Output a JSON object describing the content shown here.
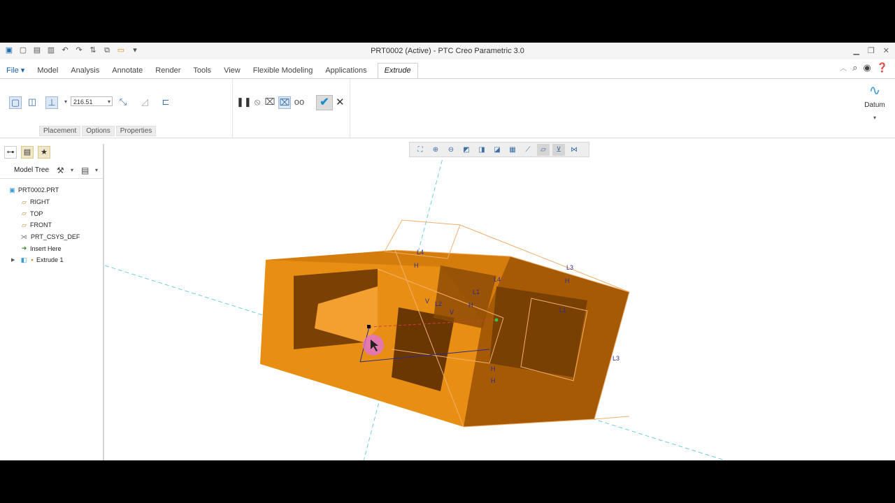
{
  "window": {
    "title": "PRT0002 (Active) - PTC Creo Parametric 3.0"
  },
  "quick_access": [
    "save-icon",
    "new-icon",
    "open-icon",
    "undo-icon",
    "redo-icon",
    "regenerate-icon",
    "windows-icon",
    "customize-icon"
  ],
  "menu": {
    "tabs": [
      "File ▾",
      "Model",
      "Analysis",
      "Annotate",
      "Render",
      "Tools",
      "View",
      "Flexible Modeling",
      "Applications"
    ],
    "active_tab": "Extrude"
  },
  "ribbon": {
    "depth_value": "216.51",
    "subtabs": [
      "Placement",
      "Options",
      "Properties"
    ],
    "datum_label": "Datum"
  },
  "model_tree": {
    "title": "Model Tree",
    "items": [
      {
        "label": "PRT0002.PRT",
        "icon": "part-icon"
      },
      {
        "label": "RIGHT",
        "icon": "datum-plane-icon"
      },
      {
        "label": "TOP",
        "icon": "datum-plane-icon"
      },
      {
        "label": "FRONT",
        "icon": "datum-plane-icon"
      },
      {
        "label": "PRT_CSYS_DEF",
        "icon": "csys-icon"
      },
      {
        "label": "Insert Here",
        "icon": "insert-arrow-icon"
      },
      {
        "label": "Extrude 1",
        "icon": "extrude-icon"
      }
    ]
  },
  "viewport": {
    "sketch_labels": [
      "L4",
      "L3",
      "L4",
      "L1",
      "L2",
      "L1",
      "L3",
      "H",
      "V"
    ]
  }
}
